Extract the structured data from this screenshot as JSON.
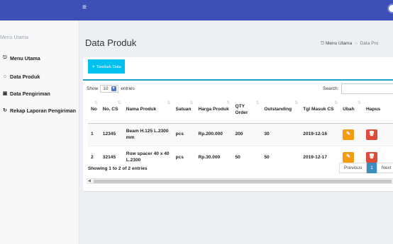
{
  "topbar": {
    "menu_icon": "≡"
  },
  "sidebar": {
    "header": "Menu Utama",
    "items": [
      {
        "label": "Menu Utama",
        "icon": "dashboard-icon"
      },
      {
        "label": "Data Produk",
        "icon": "circle-icon"
      },
      {
        "label": "Data Pengiriman",
        "icon": "truck-icon"
      },
      {
        "label": "Rekap Laporan Pengiriman",
        "icon": "history-icon"
      }
    ]
  },
  "page": {
    "title": "Data Produk",
    "breadcrumb": {
      "home": "Menu Utama",
      "current": "Data Pro"
    }
  },
  "box": {
    "add_button": "Tambah Data",
    "show_label": "Show",
    "entries_value": "10",
    "entries_label": "entries",
    "search_label": "Search:"
  },
  "table": {
    "headers": [
      "No",
      "No. CS",
      "Nama Produk",
      "Satuan",
      "Harga Produk",
      "QTY Order",
      "Outstanding",
      "Tgl Masuk CS",
      "Ubah",
      "Hapus"
    ],
    "rows": [
      [
        "1",
        "12345",
        "Beam H.125 L.2300 mm",
        "pcs",
        "Rp.200.000",
        "200",
        "30",
        "2019-12-16"
      ],
      [
        "2",
        "32145",
        "Row spacer 40 x 40 L.2300",
        "pcs",
        "Rp.30.000",
        "50",
        "50",
        "2019-12-17"
      ]
    ]
  },
  "footer": {
    "info": "Showing 1 to 2 of 2 entries",
    "pagination": {
      "previous": "Previous",
      "page": "1",
      "next": "Next"
    }
  }
}
